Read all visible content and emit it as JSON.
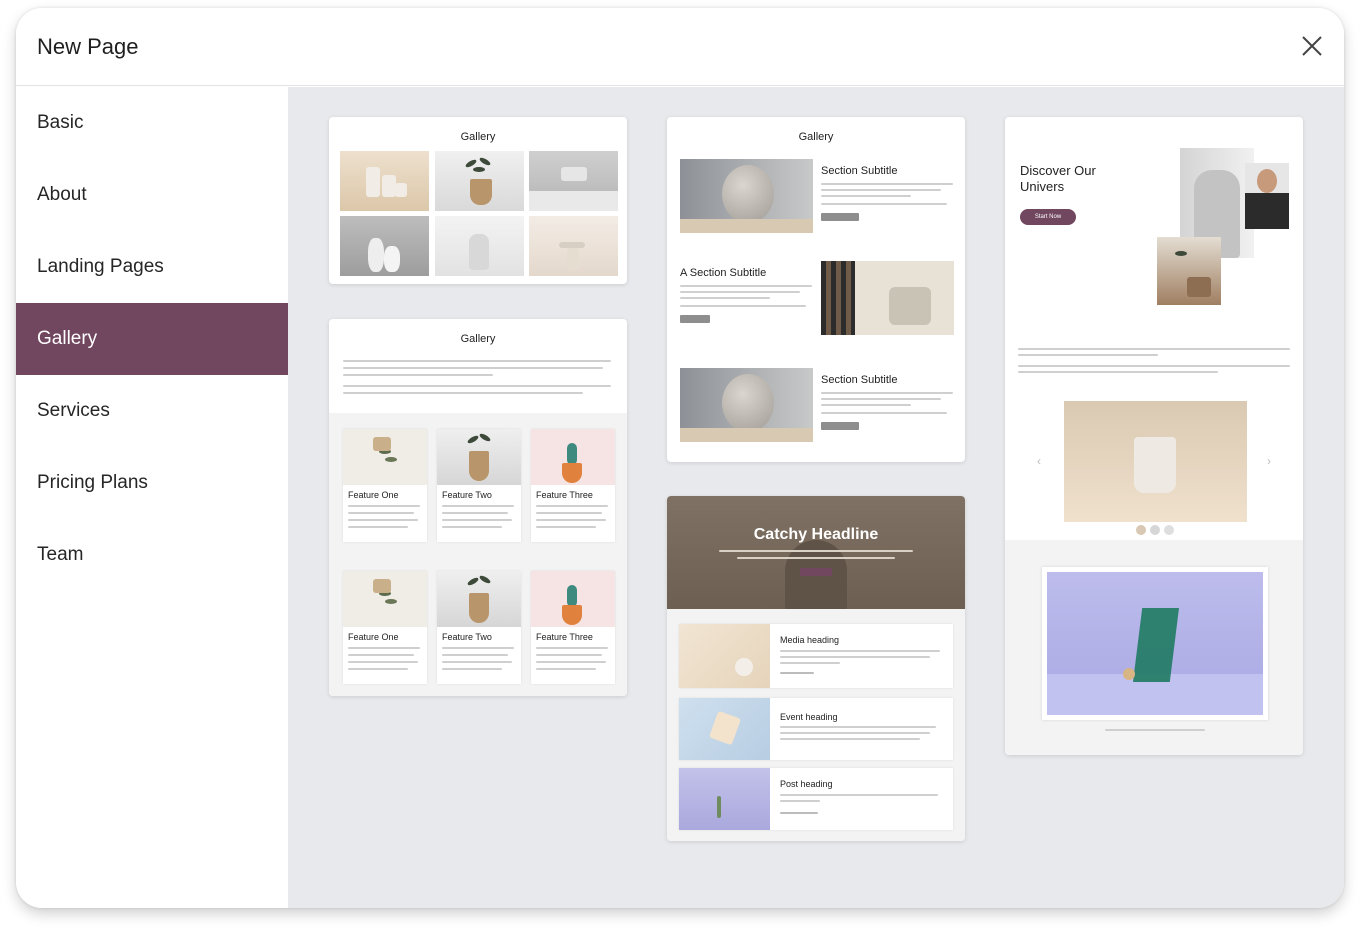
{
  "dialog": {
    "title": "New Page"
  },
  "nav": {
    "items": [
      {
        "label": "Basic"
      },
      {
        "label": "About"
      },
      {
        "label": "Landing Pages"
      },
      {
        "label": "Gallery"
      },
      {
        "label": "Services"
      },
      {
        "label": "Pricing Plans"
      },
      {
        "label": "Team"
      }
    ],
    "active_index": 3
  },
  "templates": {
    "gallery_grid": {
      "title": "Gallery"
    },
    "gallery_features": {
      "title": "Gallery",
      "features_row1": [
        {
          "title": "Feature One"
        },
        {
          "title": "Feature Two"
        },
        {
          "title": "Feature Three"
        }
      ],
      "features_row2": [
        {
          "title": "Feature One"
        },
        {
          "title": "Feature Two"
        },
        {
          "title": "Feature Three"
        }
      ]
    },
    "gallery_sections": {
      "title": "Gallery",
      "section1": "Section Subtitle",
      "section2": "A Section Subtitle",
      "section3": "Section Subtitle"
    },
    "catchy": {
      "headline": "Catchy Headline",
      "media": "Media heading",
      "event": "Event heading",
      "post": "Post heading"
    },
    "discover": {
      "headline": "Discover Our Univers",
      "button": "Start Now"
    }
  },
  "colors": {
    "accent": "#71465f",
    "canvas": "#e8e9ec",
    "text": "#262626"
  },
  "icons": {
    "close": "close-icon"
  }
}
